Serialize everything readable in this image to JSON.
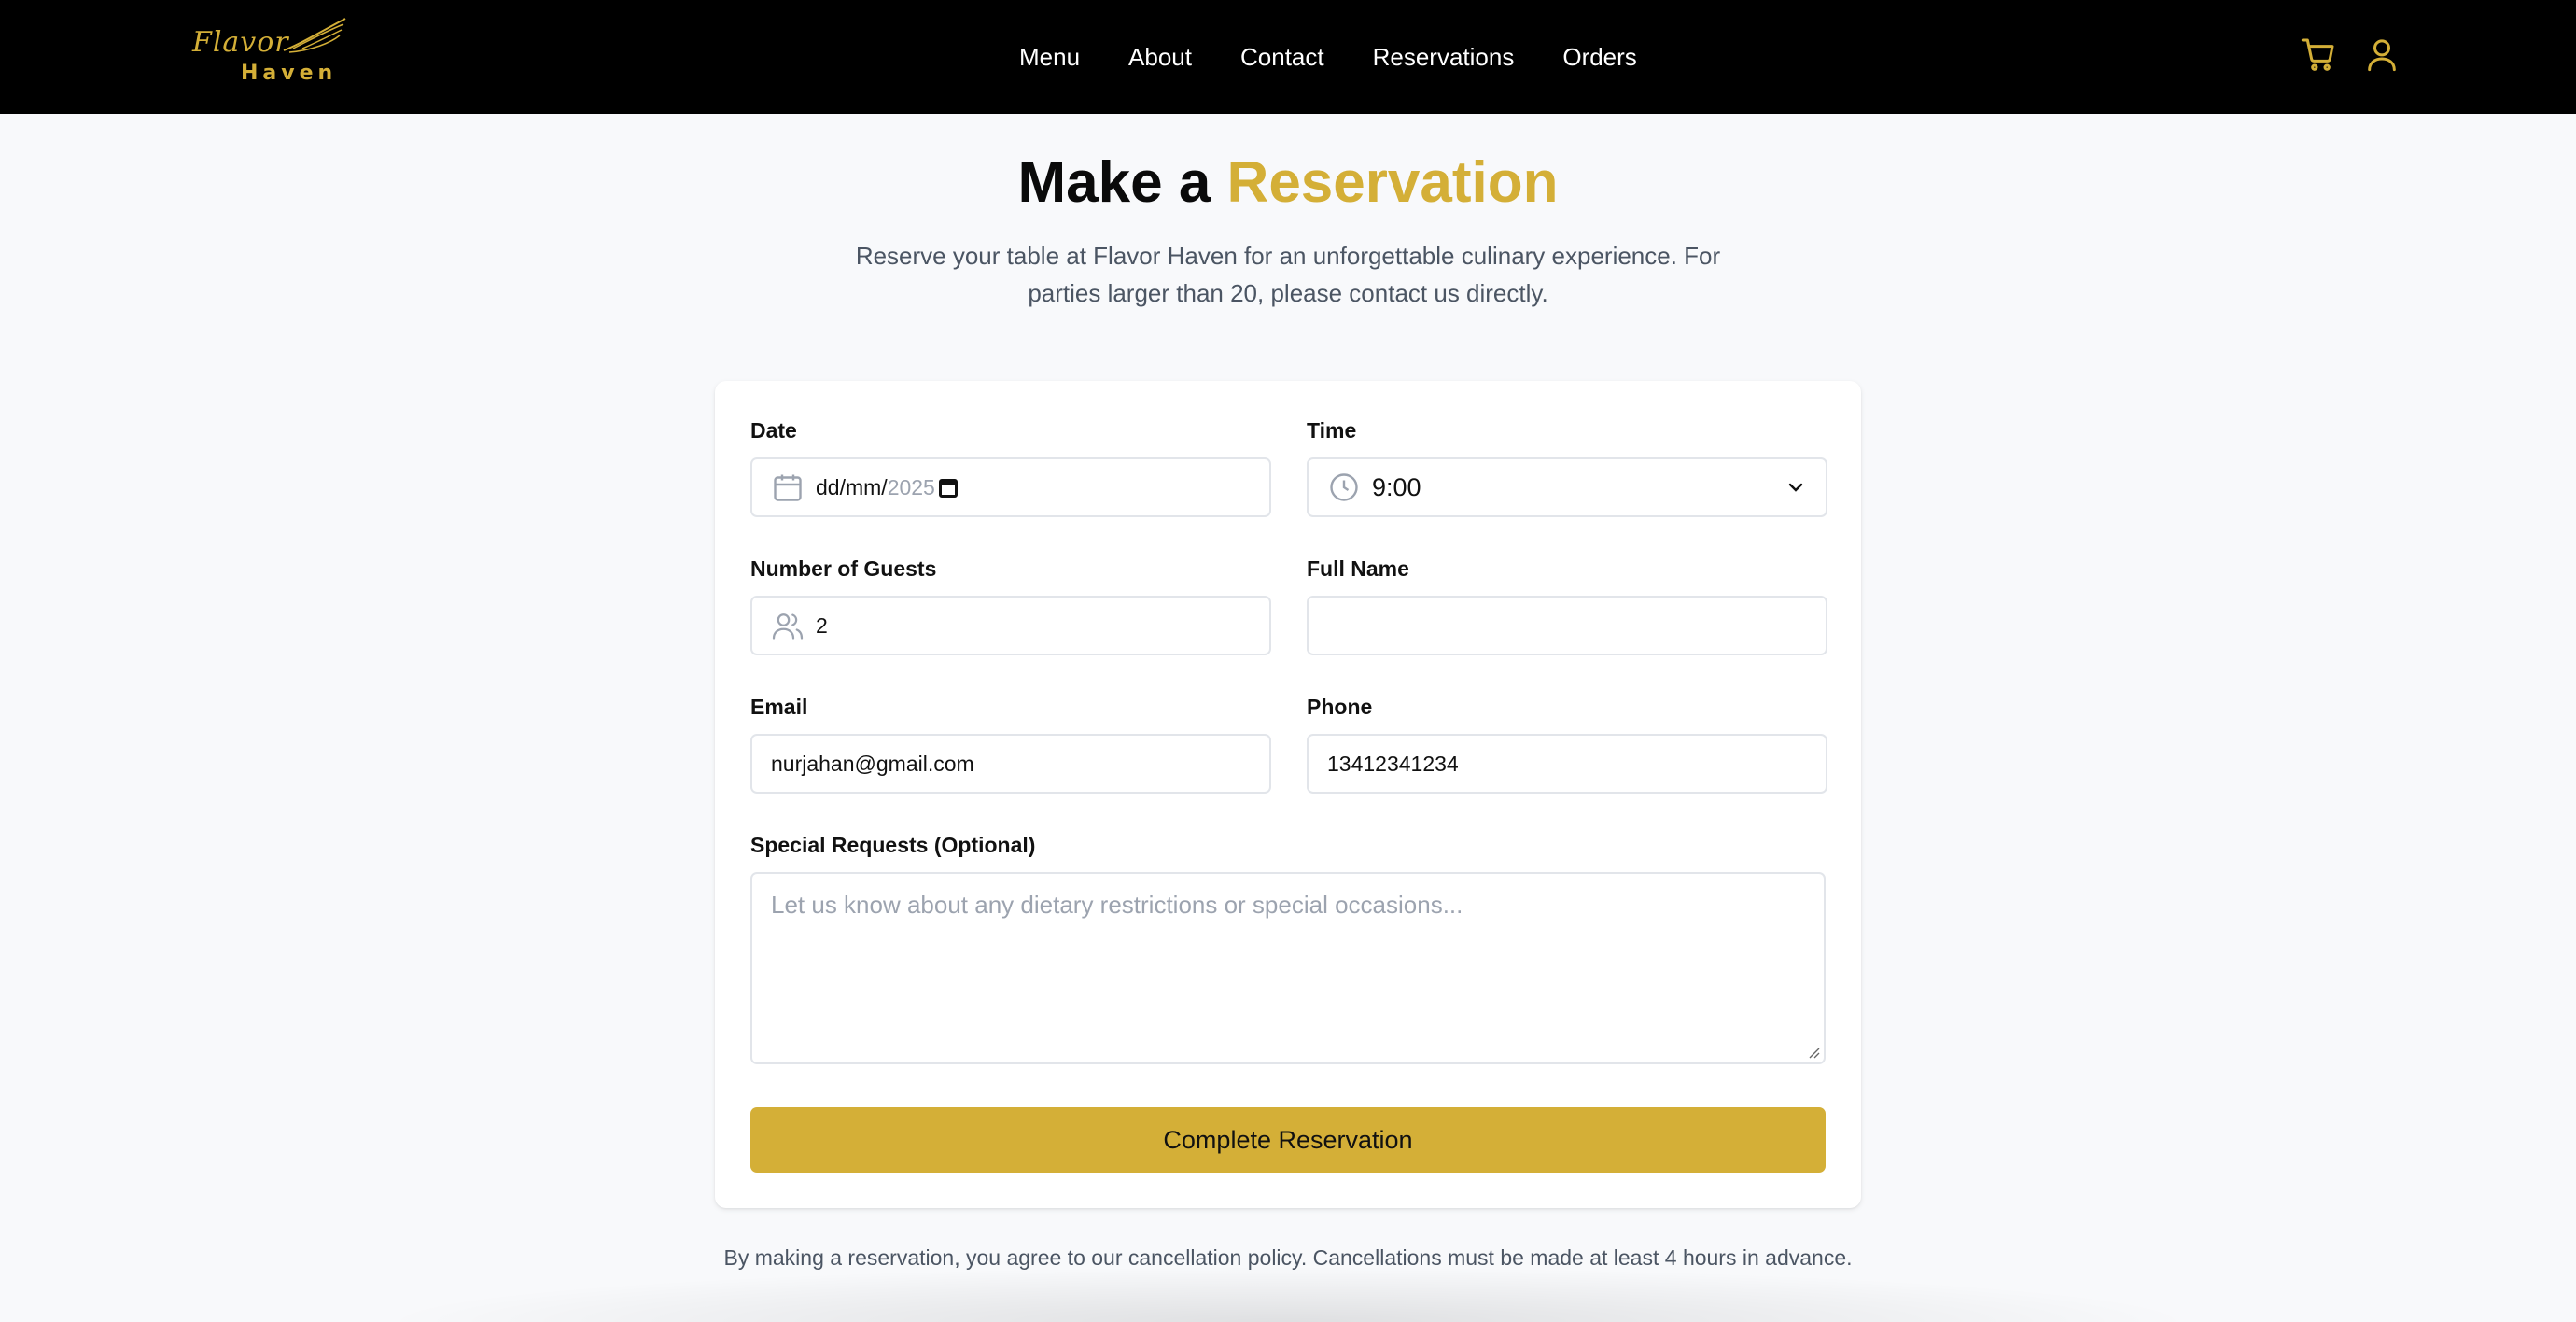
{
  "brand": {
    "logo_script": "Flavor",
    "logo_word": "Haven",
    "accent_color": "#d4af37"
  },
  "nav": {
    "items": [
      "Menu",
      "About",
      "Contact",
      "Reservations",
      "Orders"
    ]
  },
  "header_icons": [
    "cart-icon",
    "user-icon"
  ],
  "page": {
    "title_prefix": "Make a",
    "title_accent": "Reservation",
    "subtitle": "Reserve your table at Flavor Haven for an unforgettable culinary experience. For parties larger than 20, please contact us directly."
  },
  "form": {
    "date": {
      "label": "Date",
      "value_prefix": "dd/mm/",
      "value_year": "2025"
    },
    "time": {
      "label": "Time",
      "value": "9:00"
    },
    "guests": {
      "label": "Number of Guests",
      "value": "2"
    },
    "full_name": {
      "label": "Full Name",
      "value": ""
    },
    "email": {
      "label": "Email",
      "value": "nurjahan@gmail.com"
    },
    "phone": {
      "label": "Phone",
      "value": "13412341234"
    },
    "special_requests": {
      "label": "Special Requests (Optional)",
      "placeholder": "Let us know about any dietary restrictions or special occasions..."
    },
    "submit_label": "Complete Reservation"
  },
  "policy_text": "By making a reservation, you agree to our cancellation policy. Cancellations must be made at least 4 hours in advance."
}
